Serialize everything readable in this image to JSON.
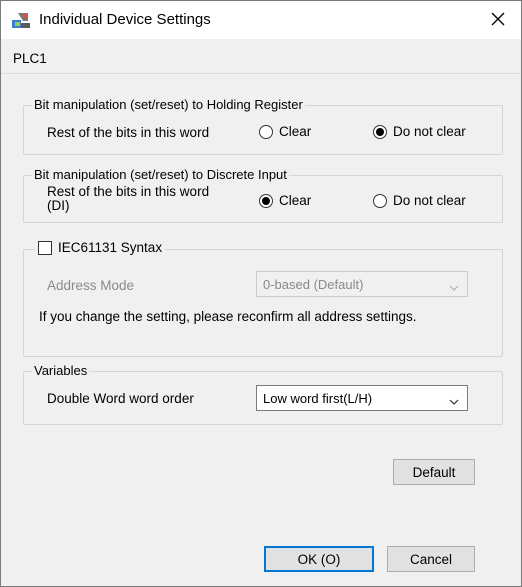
{
  "window": {
    "title": "Individual Device Settings",
    "close_glyph": "✕"
  },
  "device_name": "PLC1",
  "holding_register": {
    "legend": "Bit manipulation (set/reset) to Holding Register",
    "label": "Rest of the bits in this word",
    "options": [
      {
        "label": "Clear",
        "selected": false
      },
      {
        "label": "Do not clear",
        "selected": true
      }
    ]
  },
  "discrete_input": {
    "legend": "Bit manipulation (set/reset) to Discrete Input",
    "label_line1": "Rest of the bits in this word",
    "label_line2": "(DI)",
    "options": [
      {
        "label": "Clear",
        "selected": true
      },
      {
        "label": "Do not clear",
        "selected": false
      }
    ]
  },
  "iec": {
    "checkbox_label": "IEC61131 Syntax",
    "checked": false,
    "address_mode_label": "Address Mode",
    "address_mode_value": "0-based (Default)",
    "note": "If you change the setting, please reconfirm all address settings."
  },
  "variables": {
    "legend": "Variables",
    "dword_order_label": "Double Word word order",
    "dword_order_value": "Low word first(L/H)"
  },
  "buttons": {
    "default": "Default",
    "ok": "OK (O)",
    "cancel": "Cancel"
  },
  "colors": {
    "accent": "#0078d7",
    "window_bg": "#f0f0f0",
    "disabled_text": "#8a8a8a"
  },
  "icons": {
    "app": "app-settings-icon",
    "close": "close-icon",
    "dropdown": "chevron-down-icon"
  }
}
